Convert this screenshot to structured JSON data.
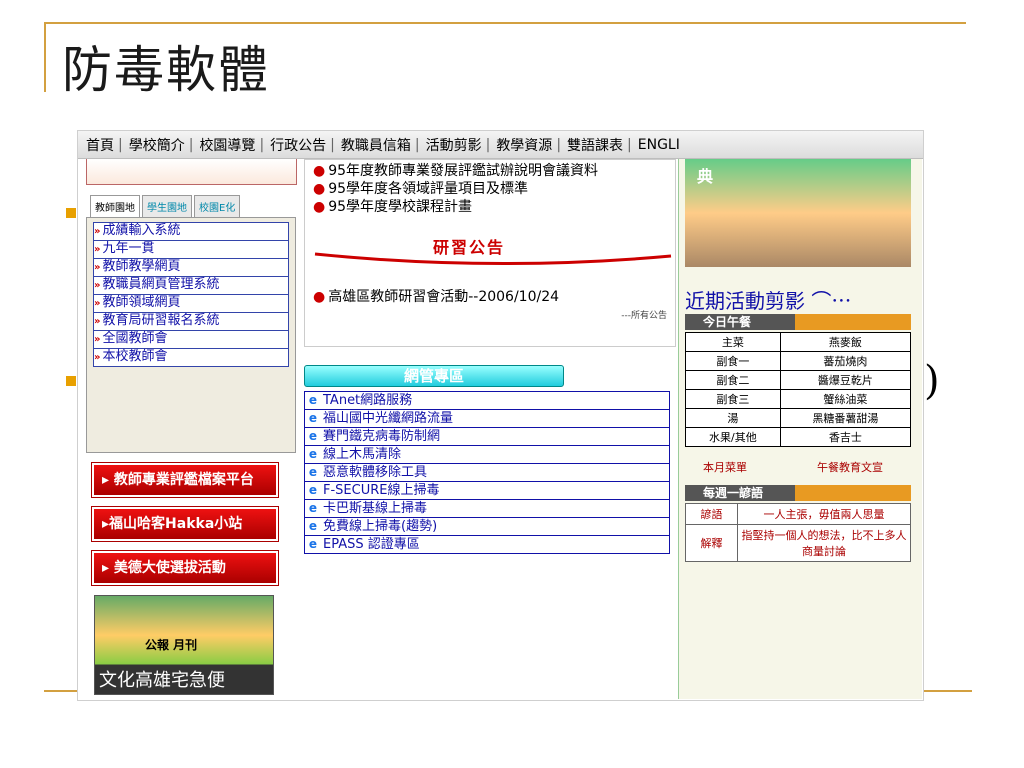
{
  "slide": {
    "title": "防毒軟體",
    "paren": ")"
  },
  "nav": {
    "items": [
      "首頁",
      "學校簡介",
      "校園導覽",
      "行政公告",
      "教職員信箱",
      "活動剪影",
      "教學資源",
      "雙語課表",
      "ENGLI"
    ]
  },
  "left": {
    "tabs": [
      "教師園地",
      "學生園地",
      "校園E化"
    ],
    "links": [
      "成績輸入系統",
      "九年一貫",
      "教師教學網頁",
      "教職員網頁管理系統",
      "教師領域網頁",
      "教育局研習報名系統",
      "全國教師會",
      "本校教師會"
    ],
    "banners": [
      "教師專業評鑑檔案平台",
      "福山哈客Hakka小站",
      "美德大使選拔活動"
    ],
    "promo_label": "公報 月刊",
    "promo_bottom": "文化高雄宅急便"
  },
  "middle": {
    "news": [
      "95年度教師專業發展評鑑試辦說明會議資料",
      "95學年度各領域評量項目及標準",
      "95學年度學校課程計畫"
    ],
    "study_heading": "研習公告",
    "study_item": "高雄區教師研習會活動--2006/10/24",
    "study_note": "---所有公告",
    "mgmt_title": "網管專區",
    "mgmt_links": [
      "TAnet網路服務",
      "福山國中光纖網路流量",
      "賽門鐵克病毒防制網",
      "線上木馬清除",
      "惡意軟體移除工具",
      "F-SECURE線上掃毒",
      "卡巴斯基線上掃毒",
      "免費線上掃毒(趨勢)",
      "EPASS 認證專區"
    ]
  },
  "right": {
    "photo_text": "典",
    "activity_title": "近期活動剪影",
    "lunch_header": "今日午餐",
    "lunch": [
      {
        "k": "主菜",
        "v": "燕麥飯"
      },
      {
        "k": "副食一",
        "v": "蕃茄燒肉"
      },
      {
        "k": "副食二",
        "v": "醬爆豆乾片"
      },
      {
        "k": "副食三",
        "v": "蟹絲油菜"
      },
      {
        "k": "湯",
        "v": "黑糖番薯甜湯"
      },
      {
        "k": "水果/其他",
        "v": "香吉士"
      }
    ],
    "menu_link": "本月菜單",
    "essay_link": "午餐教育文宣",
    "proverb_header": "每週一諺語",
    "proverb": [
      {
        "k": "諺語",
        "v": "一人主張，毋值兩人思量"
      },
      {
        "k": "解釋",
        "v": "指堅持一個人的想法，比不上多人商量討論"
      }
    ]
  },
  "colors": {
    "accent": "#d3a040",
    "link": "#1111a8",
    "alert": "#cc0000"
  }
}
